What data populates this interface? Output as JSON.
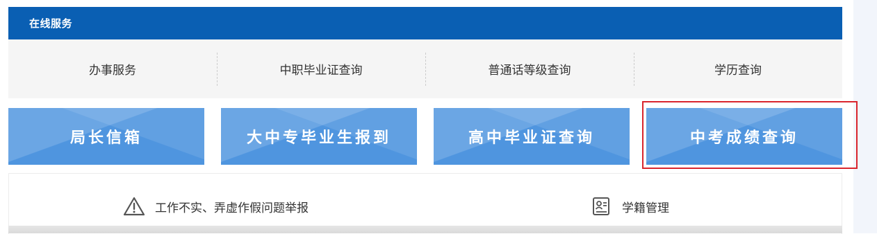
{
  "header": {
    "title": "在线服务"
  },
  "services": [
    {
      "label": "办事服务"
    },
    {
      "label": "中职毕业证查询"
    },
    {
      "label": "普通话等级查询"
    },
    {
      "label": "学历查询"
    }
  ],
  "tiles": [
    {
      "label": "局长信箱"
    },
    {
      "label": "大中专毕业生报到"
    },
    {
      "label": "高中毕业证查询"
    },
    {
      "label": "中考成绩查询"
    }
  ],
  "links": [
    {
      "label": "工作不实、弄虚作假问题举报",
      "icon": "warning-icon"
    },
    {
      "label": "学籍管理",
      "icon": "id-card-icon"
    }
  ],
  "colors": {
    "header_bg": "#0a5fb3",
    "tile_bg": "#4f95df",
    "highlight": "#d9242c"
  }
}
